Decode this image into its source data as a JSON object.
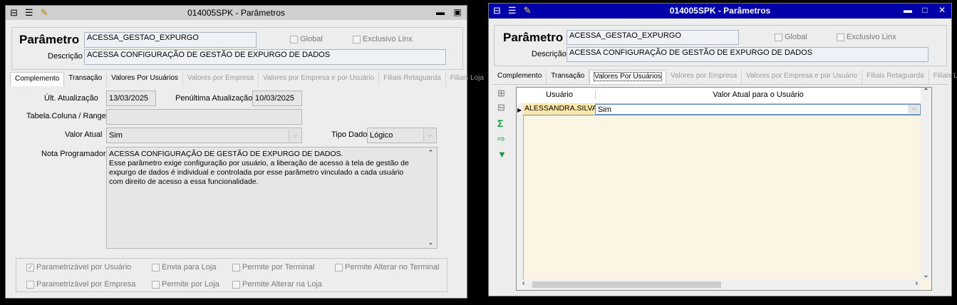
{
  "left": {
    "title": "014005SPK - Parâmetros",
    "parametro_label": "Parâmetro",
    "parametro_value": "ACESSA_GESTAO_EXPURGO",
    "global_label": "Global",
    "exclusivo_label": "Exclusivo Linx",
    "descricao_label": "Descrição",
    "descricao_value": "ACESSA CONFIGURAÇÃO DE GESTÃO DE EXPURGO DE DADOS",
    "tabs": [
      "Complemento",
      "Transação",
      "Valores Por Usuários",
      "Valores por Empresa",
      "Valores por Empresa e por Usuário",
      "Filiais Retaguarda",
      "Filiais Loja"
    ],
    "ult_atualizacao_label": "Últ. Atualização",
    "ult_atualizacao_value": "13/03/2025",
    "penultima_label": "Penúltima Atualização",
    "penultima_value": "10/03/2025",
    "tabela_coluna_label": "Tabela.Coluna / Range",
    "tabela_coluna_value": "",
    "valor_atual_label": "Valor Atual",
    "valor_atual_value": "Sim",
    "tipo_dado_label": "Tipo Dado",
    "tipo_dado_value": "Lógico",
    "nota_label": "Nota Programador",
    "nota_lines": [
      "ACESSA CONFIGURAÇÃO DE GESTÃO DE EXPURGO DE DADOS.",
      "Esse parâmetro exige configuração por usuário, a liberação de acesso à tela de gestão de",
      "expurgo de dados é individual e controlada por esse parâmetro vinculado a cada usuário",
      "com direito de acesso a essa funcionalidade."
    ],
    "checkboxes": [
      {
        "label": "Parametrizável por Usuário",
        "checked": true
      },
      {
        "label": "Envia para Loja",
        "checked": false
      },
      {
        "label": "Permite por Terminal",
        "checked": false
      },
      {
        "label": "Permite Alterar no Terminal",
        "checked": false
      },
      {
        "label": "Parametrizável por Empresa",
        "checked": false
      },
      {
        "label": "Permite por Loja",
        "checked": false
      },
      {
        "label": "Permite Alterar na Loja",
        "checked": false
      }
    ]
  },
  "right": {
    "title": "014005SPK - Parâmetros",
    "parametro_label": "Parâmetro",
    "parametro_value": "ACESSA_GESTAO_EXPURGO",
    "global_label": "Global",
    "exclusivo_label": "Exclusivo Linx",
    "descricao_label": "Descrição",
    "descricao_value": "ACESSA CONFIGURAÇÃO DE GESTÃO DE EXPURGO DE DADOS",
    "tabs": [
      "Complemento",
      "Transação",
      "Valores Por Usuários",
      "Valores por Empresa",
      "Valores por Empresa e por Usuário",
      "Filiais Retaguarda",
      "Filiais Loja"
    ],
    "grid_headers": [
      "Usuário",
      "Valor Atual para o Usuário"
    ],
    "grid_rows": [
      {
        "usuario": "ALESSANDRA.SILVA",
        "valor": "Sim"
      }
    ],
    "title_bar_color": "#0000a8"
  }
}
